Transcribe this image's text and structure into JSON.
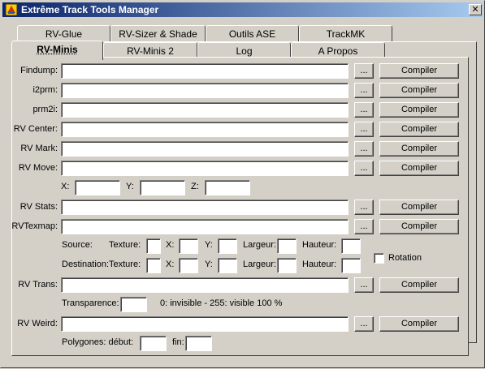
{
  "window": {
    "title": "Extrême Track Tools Manager",
    "close_glyph": "✕",
    "app_icon": "app-icon"
  },
  "tabs_back": [
    "RV-Glue",
    "RV-Sizer & Shade",
    "Outils ASE",
    "TrackMK"
  ],
  "tabs_front": [
    "RV-Minis",
    "RV-Minis 2",
    "Log",
    "A Propos"
  ],
  "active_tab": "RV-Minis",
  "browse_label": "...",
  "compile_label": "Compiler",
  "rows": {
    "findump": "Findump:",
    "i2prm": "i2prm:",
    "prm2i": "prm2i:",
    "rvcenter": "RV Center:",
    "rvmark": "RV Mark:",
    "rvmove": "RV Move:",
    "rvstats": "RV Stats:",
    "rvtexmap": "RVTexmap:",
    "rvtrans": "RV Trans:",
    "rvweird": "RV Weird:"
  },
  "move": {
    "x": "X:",
    "y": "Y:",
    "z": "Z:"
  },
  "texmap": {
    "source": "Source:",
    "destination": "Destination:",
    "texture": "Texture:",
    "x": "X:",
    "y": "Y:",
    "largeur": "Largeur:",
    "hauteur": "Hauteur:",
    "rotation": "Rotation"
  },
  "trans": {
    "label": "Transparence:",
    "hint": "0: invisible - 255: visible 100 %"
  },
  "weird": {
    "debut": "Polygones: début:",
    "fin": "fin:"
  }
}
